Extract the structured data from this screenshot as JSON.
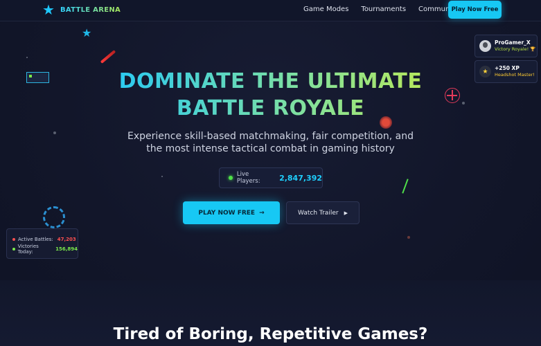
{
  "nav": {
    "brand": "BATTLE ARENA",
    "links": [
      "Game Modes",
      "Tournaments",
      "Community"
    ],
    "cta": "Play Now Free"
  },
  "hero": {
    "title_line1": "DOMINATE THE ULTIMATE",
    "title_line2": "BATTLE ROYALE",
    "subtitle": "Experience skill-based matchmaking, fair competition, and the most intense tactical combat in gaming history",
    "live_label": "Live Players:",
    "live_value": "2,847,392",
    "primary_button": "PLAY NOW FREE",
    "primary_arrow": "→",
    "secondary_button": "Watch Trailer",
    "secondary_icon": "▶"
  },
  "stats": {
    "active_label": "Active Battles:",
    "active_value": "47,203",
    "victories_label": "Victories Today:",
    "victories_value": "156,894"
  },
  "notifications": [
    {
      "title": "ProGamer_X",
      "subtitle": "Victory Royale! 🏆"
    },
    {
      "title": "+250 XP",
      "subtitle": "Headshot Master!"
    }
  ],
  "section_heading": "Tired of Boring, Repetitive Games?",
  "colors": {
    "accent": "#17c8f4",
    "live_dot": "#4fe04a",
    "red": "#ff5050",
    "green": "#7be94b"
  },
  "icons": {
    "brand": "star-icon",
    "arrow": "arrow-right-icon",
    "play": "play-icon",
    "coin": "star-coin-icon"
  }
}
